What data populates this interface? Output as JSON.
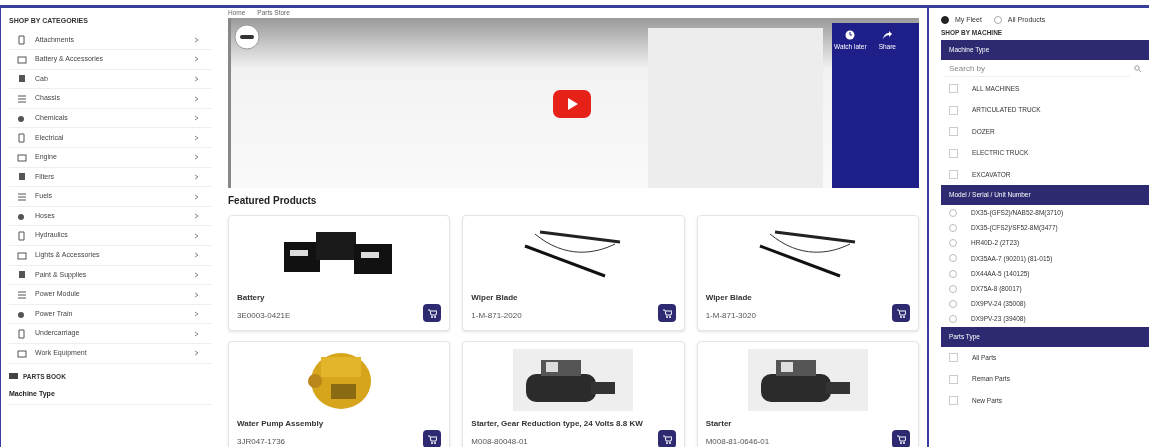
{
  "sidebar": {
    "title": "SHOP BY CATEGORIES",
    "categories": [
      {
        "label": "Attachments"
      },
      {
        "label": "Battery & Accessories"
      },
      {
        "label": "Cab"
      },
      {
        "label": "Chassis"
      },
      {
        "label": "Chemicals"
      },
      {
        "label": "Electrical"
      },
      {
        "label": "Engine"
      },
      {
        "label": "Filters"
      },
      {
        "label": "Fuels"
      },
      {
        "label": "Hoses"
      },
      {
        "label": "Hydraulics"
      },
      {
        "label": "Lights & Accessories"
      },
      {
        "label": "Paint & Supplies"
      },
      {
        "label": "Power Module"
      },
      {
        "label": "Power Train"
      },
      {
        "label": "Undercarriage"
      },
      {
        "label": "Work Equipment"
      }
    ],
    "parts_book": "PARTS BOOK",
    "machine_type": "Machine Type"
  },
  "breadcrumb": [
    "Home",
    "Parts Store"
  ],
  "video": {
    "controls": [
      {
        "label": "Watch later"
      },
      {
        "label": "Share"
      }
    ]
  },
  "featured": {
    "title": "Featured Products",
    "products": [
      {
        "name": "Battery",
        "number": "3E0003-0421E"
      },
      {
        "name": "Wiper Blade",
        "number": "1-M-871-2020"
      },
      {
        "name": "Wiper Blade",
        "number": "1-M-871-3020"
      },
      {
        "name": "Water Pump Assembly",
        "number": "3JR047-1736"
      },
      {
        "name": "Starter, Gear Reduction type, 24 Volts 8.8 KW",
        "number": "M008-80048-01"
      },
      {
        "name": "Starter",
        "number": "M008-81-0646-01"
      }
    ]
  },
  "filters": {
    "scope": [
      {
        "label": "My Fleet",
        "selected": true
      },
      {
        "label": "All Products",
        "selected": false
      }
    ],
    "title": "SHOP BY MACHINE",
    "sections": [
      {
        "header": "Machine Type",
        "search_placeholder": "Search by",
        "kind": "checkbox",
        "items": [
          {
            "label": "ALL MACHINES",
            "checked": false
          },
          {
            "label": "ARTICULATED TRUCK",
            "checked": false
          },
          {
            "label": "DOZER",
            "checked": false
          },
          {
            "label": "ELECTRIC TRUCK",
            "checked": false
          },
          {
            "label": "EXCAVATOR",
            "checked": false
          }
        ]
      },
      {
        "header": "Model / Serial / Unit Number",
        "kind": "radio",
        "items": [
          {
            "label": "DX35-(GFS2)/NAB52-8M(3710)",
            "checked": false
          },
          {
            "label": "DX35-(CFS2)/SF52-8M(3477)",
            "checked": false
          },
          {
            "label": "HR40D-2 (2T23)",
            "checked": false
          },
          {
            "label": "DX35AA-7 (90201) (81-015)",
            "checked": false
          },
          {
            "label": "DX44AA-5 (140125)",
            "checked": false
          },
          {
            "label": "DX75A-8 (80017)",
            "checked": false
          },
          {
            "label": "DX9PV-24 (35008)",
            "checked": false
          },
          {
            "label": "DX9PV-23 (39408)",
            "checked": false
          }
        ]
      },
      {
        "header": "Parts Type",
        "kind": "checkbox",
        "items": [
          {
            "label": "All Parts",
            "checked": false
          },
          {
            "label": "Reman Parts",
            "checked": false
          },
          {
            "label": "New Parts",
            "checked": false
          }
        ]
      }
    ]
  }
}
